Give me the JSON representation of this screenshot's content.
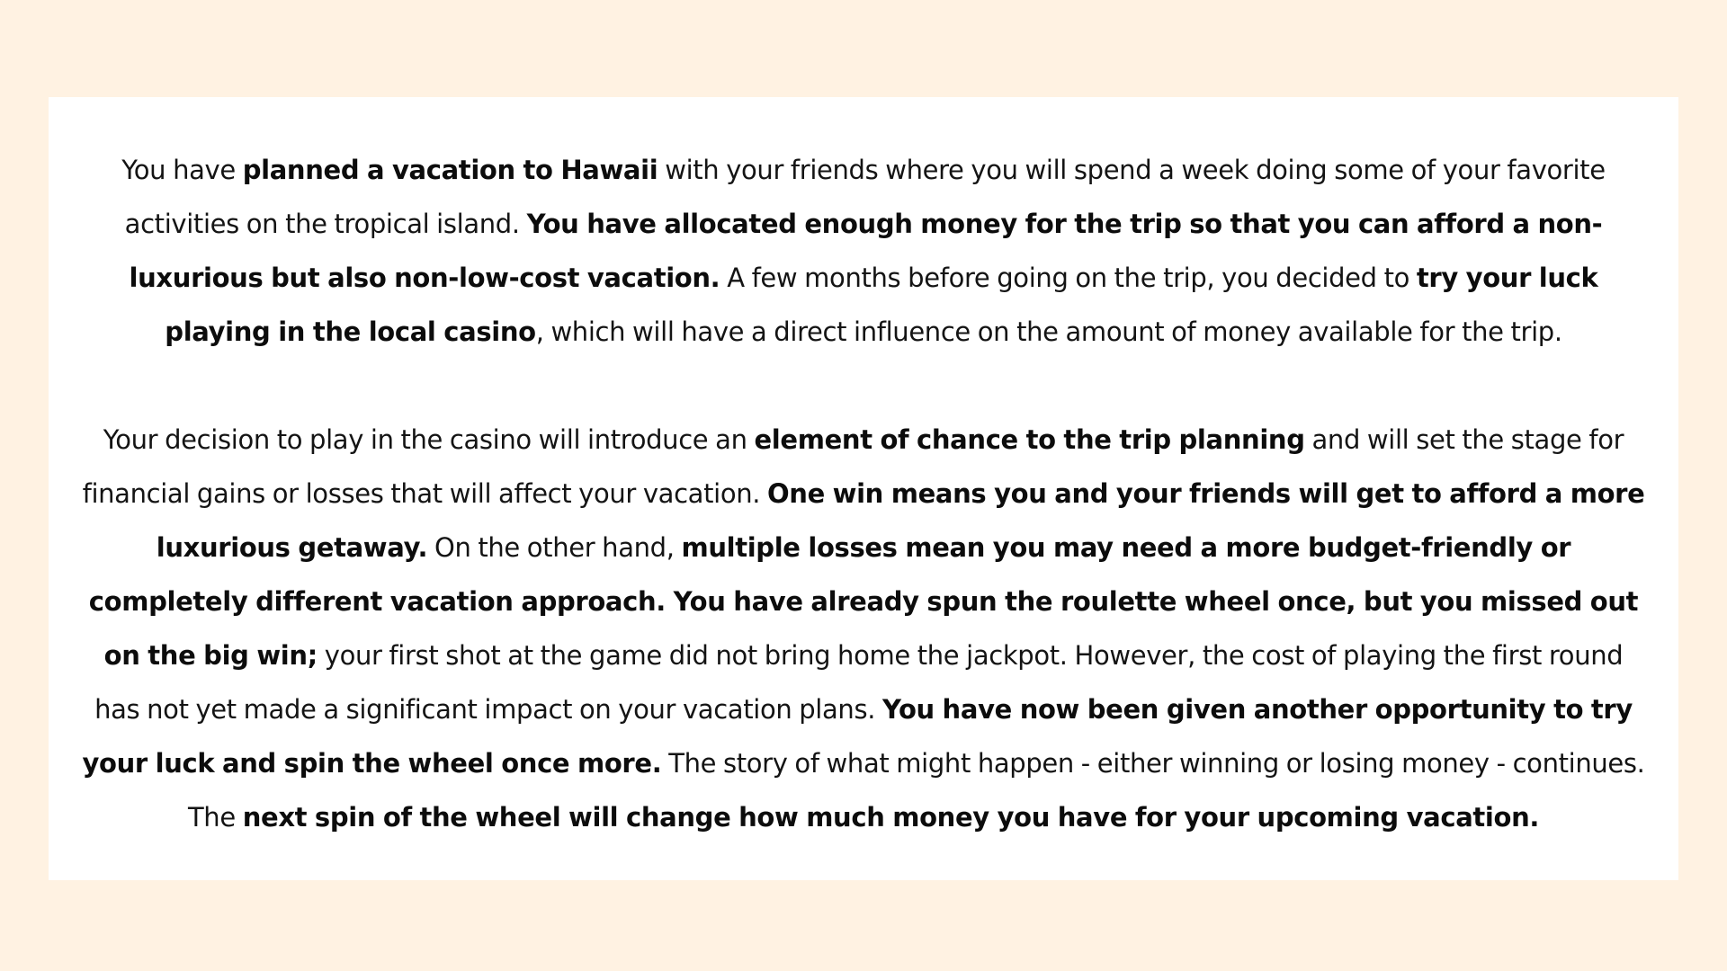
{
  "paragraphs": [
    {
      "segments": [
        {
          "text": "You have ",
          "bold": false
        },
        {
          "text": "planned a vacation to Hawaii",
          "bold": true
        },
        {
          "text": " with your friends where you will spend a week doing some of your favorite activities on the tropical island. ",
          "bold": false
        },
        {
          "text": "You have allocated enough money for the trip so that you can afford a non-luxurious but also non-low-cost vacation.",
          "bold": true
        },
        {
          "text": " A few months before going on the trip, you decided to ",
          "bold": false
        },
        {
          "text": "try your luck playing in the local casino",
          "bold": true
        },
        {
          "text": ", which will have a direct influence on the amount of money available for the trip.",
          "bold": false
        }
      ]
    },
    {
      "segments": [
        {
          "text": "Your decision to play in the casino will introduce an ",
          "bold": false
        },
        {
          "text": "element of chance to the trip planning",
          "bold": true
        },
        {
          "text": " and will set the stage for financial gains or losses that will affect your vacation. ",
          "bold": false
        },
        {
          "text": "One win means you and your friends will get to afford a more luxurious getaway.",
          "bold": true
        },
        {
          "text": " On the other hand, ",
          "bold": false
        },
        {
          "text": "multiple losses mean you may need a more budget-friendly or completely different vacation approach. You have already spun the roulette wheel once, but you missed out on the big win;",
          "bold": true
        },
        {
          "text": " your first shot at the game did not bring home the jackpot. However, the cost of playing the first round has not yet made a significant impact on your vacation plans. ",
          "bold": false
        },
        {
          "text": "You have now been given another opportunity to try your luck and spin the wheel once more.",
          "bold": true
        },
        {
          "text": " The story of what might happen - either winning or losing money - continues. The ",
          "bold": false
        },
        {
          "text": "next spin of the wheel will change how much money you have for your upcoming vacation.",
          "bold": true
        }
      ]
    }
  ]
}
